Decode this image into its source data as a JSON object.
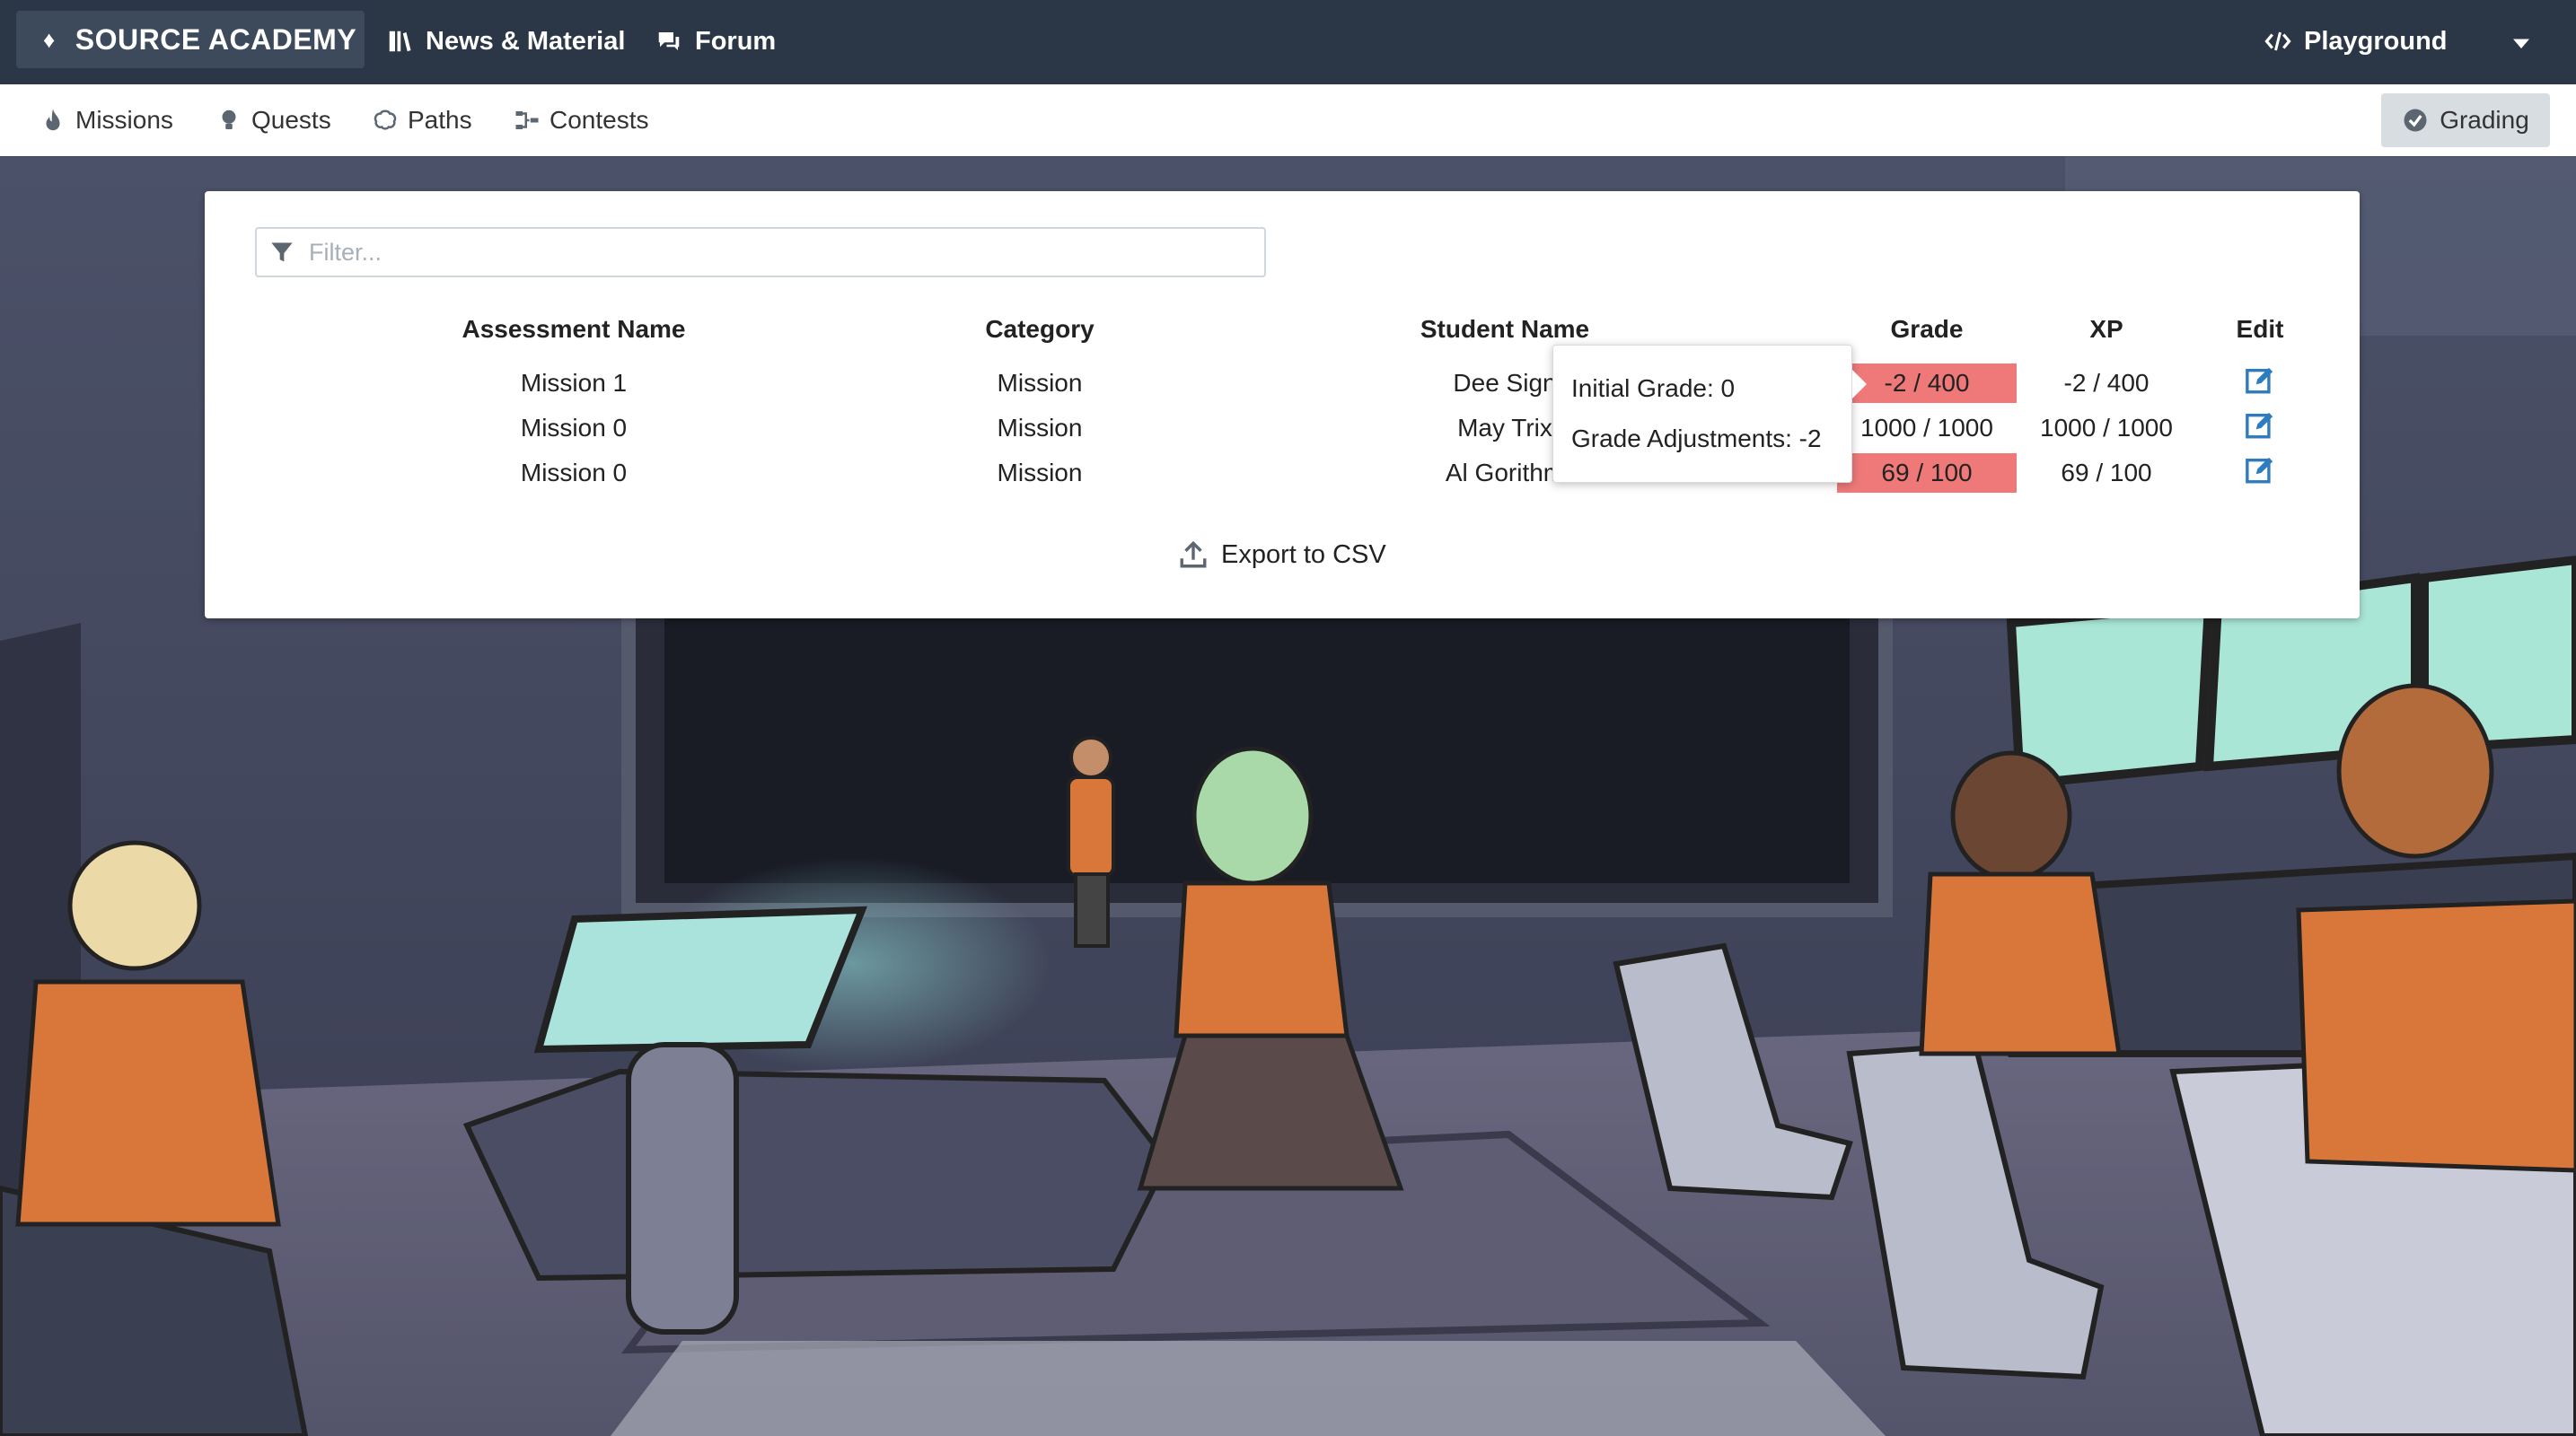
{
  "navbar": {
    "brand": "SOURCE ACADEMY",
    "news": "News & Material",
    "forum": "Forum",
    "playground": "Playground"
  },
  "subnav": {
    "missions": "Missions",
    "quests": "Quests",
    "paths": "Paths",
    "contests": "Contests",
    "grading": "Grading"
  },
  "filter": {
    "placeholder": "Filter..."
  },
  "table": {
    "headers": {
      "assessment": "Assessment Name",
      "category": "Category",
      "student": "Student Name",
      "grade": "Grade",
      "xp": "XP",
      "edit": "Edit"
    },
    "rows": [
      {
        "assessment": "Mission 1",
        "category": "Mission",
        "student": "Dee Sign",
        "grade": "-2 / 400",
        "xp": "-2 / 400"
      },
      {
        "assessment": "Mission 0",
        "category": "Mission",
        "student": "May Trix",
        "grade": "1000 / 1000",
        "xp": "1000 / 1000"
      },
      {
        "assessment": "Mission 0",
        "category": "Mission",
        "student": "Al Gorithm",
        "grade": "69 / 100",
        "xp": "69 / 100"
      }
    ]
  },
  "export": "Export to CSV",
  "tooltip": {
    "line1": "Initial Grade: 0",
    "line2": "Grade Adjustments: -2"
  },
  "colors": {
    "navbar_bg": "#2b3746",
    "grade_highlight": "#ef7979",
    "edit_icon": "#2f7bbf"
  }
}
